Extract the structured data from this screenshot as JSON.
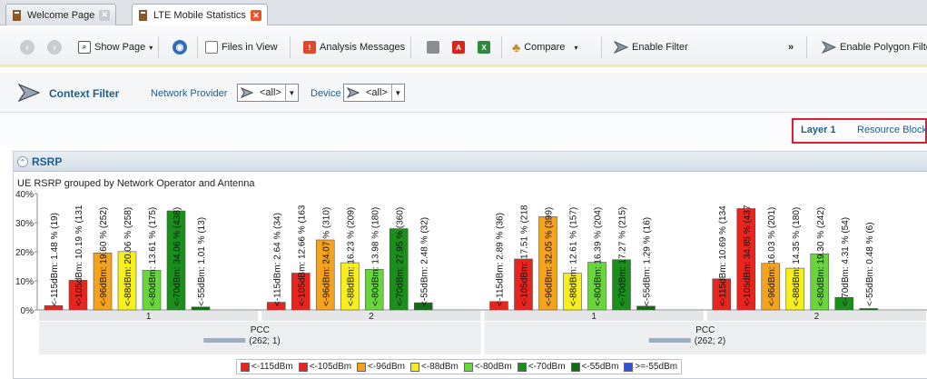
{
  "tabs": [
    {
      "label": "Welcome Page",
      "active": false
    },
    {
      "label": "LTE Mobile Statistics",
      "active": true
    }
  ],
  "toolbar": {
    "show_page": "Show Page",
    "files_in_view": "Files in View",
    "analysis_messages": "Analysis Messages",
    "compare": "Compare",
    "enable_filter": "Enable Filter",
    "overflow": "»",
    "enable_polygon_filter": "Enable Polygon Filter"
  },
  "context_filter": {
    "title": "Context Filter",
    "network_provider_label": "Network Provider",
    "network_provider_value": "<all>",
    "device_label": "Device",
    "device_value": "<all>"
  },
  "layer_tabs": [
    "Layer 1",
    "Resource Blocks"
  ],
  "section": {
    "title": "RSRP"
  },
  "chart_data": {
    "type": "bar",
    "title": "UE RSRP grouped by Network Operator and Antenna",
    "ylim": [
      0,
      40
    ],
    "yticks": [
      "40%",
      "30%",
      "20%",
      "10%",
      "0%"
    ],
    "series_names": [
      "<-115dBm",
      "<-105dBm",
      "<-96dBm",
      "<-88dBm",
      "<-80dBm",
      "<-70dBm",
      "<-55dBm",
      ">=-55dBm"
    ],
    "colors": [
      "#e8241f",
      "#e8241f",
      "#f7a21b",
      "#f6ee1d",
      "#66d63a",
      "#1b8f1b",
      "#0f6e0f",
      "#3050d8"
    ],
    "groups": [
      {
        "label": "1",
        "bars": [
          {
            "series": 0,
            "value": 1.48,
            "count": 19,
            "label": "<-115dBm: 1.48 % (19)"
          },
          {
            "series": 1,
            "value": 10.19,
            "count": 131,
            "label": "<-105dBm: 10.19 % (131"
          },
          {
            "series": 2,
            "value": 19.6,
            "count": 252,
            "label": "<-96dBm: 19.60 % (252)"
          },
          {
            "series": 3,
            "value": 20.06,
            "count": 258,
            "label": "<-88dBm: 20.06 % (258)"
          },
          {
            "series": 4,
            "value": 13.61,
            "count": 175,
            "label": "<-80dBm: 13.61 % (175)"
          },
          {
            "series": 5,
            "value": 34.06,
            "count": 438,
            "label": "<-70dBm: 34.06 % (438)"
          },
          {
            "series": 6,
            "value": 1.01,
            "count": 13,
            "label": "<-55dBm: 1.01 % (13)"
          }
        ]
      },
      {
        "label": "2",
        "bars": [
          {
            "series": 0,
            "value": 2.64,
            "count": 34,
            "label": "<-115dBm: 2.64 % (34)"
          },
          {
            "series": 1,
            "value": 12.66,
            "count": 163,
            "label": "<-105dBm: 12.66 % (163"
          },
          {
            "series": 2,
            "value": 24.07,
            "count": 310,
            "label": "<-96dBm: 24.07 % (310)"
          },
          {
            "series": 3,
            "value": 16.23,
            "count": 209,
            "label": "<-88dBm: 16.23 % (209)"
          },
          {
            "series": 4,
            "value": 13.98,
            "count": 180,
            "label": "<-80dBm: 13.98 % (180)"
          },
          {
            "series": 5,
            "value": 27.95,
            "count": 360,
            "label": "<-70dBm: 27.95 % (360)"
          },
          {
            "series": 6,
            "value": 2.48,
            "count": 32,
            "label": "<-55dBm: 2.48 % (32)"
          }
        ]
      },
      {
        "label": "1",
        "bars": [
          {
            "series": 0,
            "value": 2.89,
            "count": 36,
            "label": "<-115dBm: 2.89 % (36)"
          },
          {
            "series": 1,
            "value": 17.51,
            "count": 218,
            "label": "<-105dBm: 17.51 % (218"
          },
          {
            "series": 2,
            "value": 32.05,
            "count": 399,
            "label": "<-96dBm: 32.05 % (399)"
          },
          {
            "series": 3,
            "value": 12.61,
            "count": 157,
            "label": "<-88dBm: 12.61 % (157)"
          },
          {
            "series": 4,
            "value": 16.39,
            "count": 204,
            "label": "<-80dBm: 16.39 % (204)"
          },
          {
            "series": 5,
            "value": 17.27,
            "count": 215,
            "label": "<-70dBm: 17.27 % (215)"
          },
          {
            "series": 6,
            "value": 1.29,
            "count": 16,
            "label": "<-55dBm: 1.29 % (16)"
          }
        ]
      },
      {
        "label": "2",
        "bars": [
          {
            "series": 0,
            "value": 10.69,
            "count": 134,
            "label": "<-115dBm: 10.69 % (134"
          },
          {
            "series": 1,
            "value": 34.85,
            "count": 437,
            "label": "<-105dBm: 34.85 % (437"
          },
          {
            "series": 2,
            "value": 16.03,
            "count": 201,
            "label": "<-96dBm: 16.03 % (201)"
          },
          {
            "series": 3,
            "value": 14.35,
            "count": 180,
            "label": "<-88dBm: 14.35 % (180)"
          },
          {
            "series": 4,
            "value": 19.3,
            "count": 242,
            "label": "<-80dBm: 19.30 % (242)"
          },
          {
            "series": 5,
            "value": 4.31,
            "count": 54,
            "label": "<-70dBm: 4.31 % (54)"
          },
          {
            "series": 6,
            "value": 0.48,
            "count": 6,
            "label": "<-55dBm: 0.48 % (6)"
          }
        ]
      }
    ],
    "operators": [
      {
        "label": "PCC",
        "sub": "(262; 1)"
      },
      {
        "label": "PCC",
        "sub": "(262; 2)"
      }
    ],
    "legend": [
      "<-115dBm",
      "<-105dBm",
      "<-96dBm",
      "<-88dBm",
      "<-80dBm",
      "<-70dBm",
      "<-55dBm",
      ">=-55dBm"
    ],
    "grid": false
  }
}
